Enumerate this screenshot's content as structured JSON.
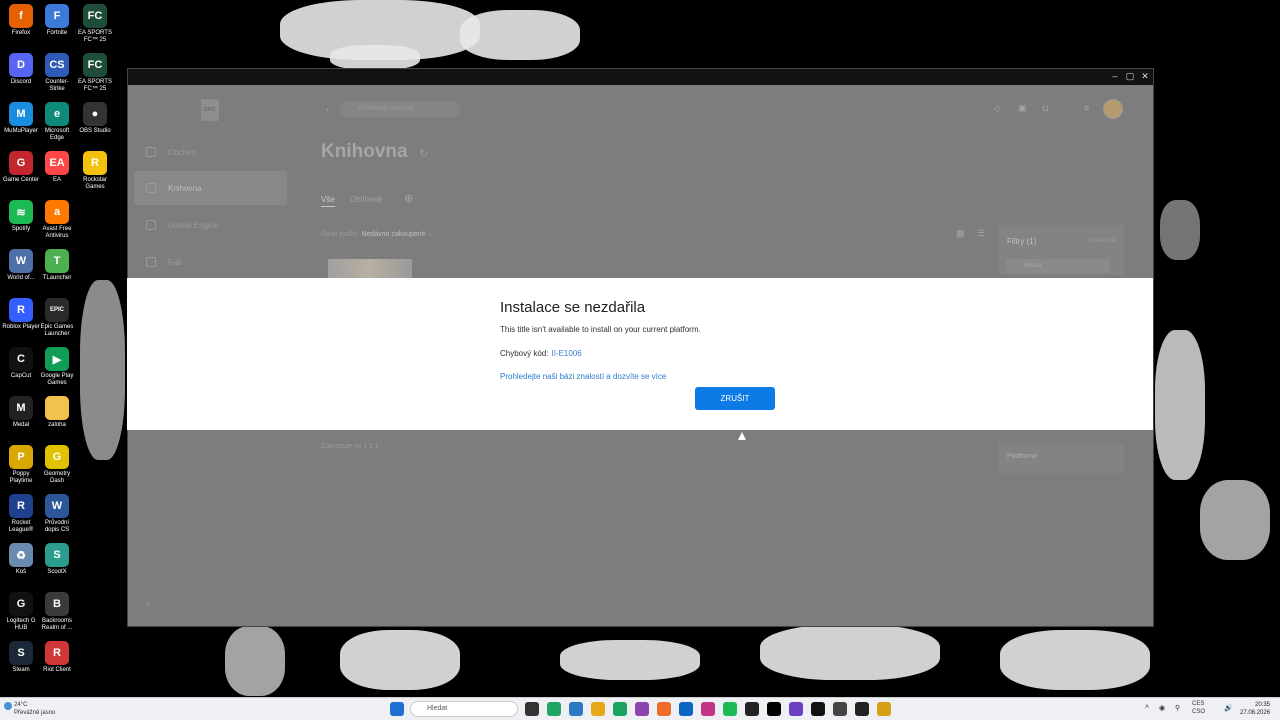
{
  "desktop": {
    "icons": [
      {
        "label": "Firefox",
        "color": "#e66000",
        "glyph": "f"
      },
      {
        "label": "Fortnite",
        "color": "#3b7ad9",
        "glyph": "F"
      },
      {
        "label": "EA SPORTS FC™ 25",
        "color": "#1e4d3a",
        "glyph": "FC"
      },
      {
        "label": "Discord",
        "color": "#5865f2",
        "glyph": "D"
      },
      {
        "label": "Counter-Strike",
        "color": "#2d5bb5",
        "glyph": "CS"
      },
      {
        "label": "EA SPORTS FC™ 25",
        "color": "#1e4d3a",
        "glyph": "FC"
      },
      {
        "label": "MuMuPlayer",
        "color": "#1b8de0",
        "glyph": "M"
      },
      {
        "label": "Microsoft Edge",
        "color": "#0f8a78",
        "glyph": "e"
      },
      {
        "label": "OBS Studio",
        "color": "#333333",
        "glyph": "●"
      },
      {
        "label": "Game Center",
        "color": "#c1272d",
        "glyph": "G"
      },
      {
        "label": "EA",
        "color": "#ff4747",
        "glyph": "EA"
      },
      {
        "label": "Rockstar Games",
        "color": "#f4c20d",
        "glyph": "R"
      },
      {
        "label": "Spotify",
        "color": "#1db954",
        "glyph": "≋"
      },
      {
        "label": "Avast Free Antivirus",
        "color": "#ff7800",
        "glyph": "a"
      },
      {
        "label": "World of...",
        "color": "#4f6fa8",
        "glyph": "W"
      },
      {
        "label": "TLauncher",
        "color": "#4caf50",
        "glyph": "T"
      },
      {
        "label": "Roblox Player",
        "color": "#335fff",
        "glyph": "R"
      },
      {
        "label": "Epic Games Launcher",
        "color": "#2a2a2a",
        "glyph": "EPIC"
      },
      {
        "label": "CapCut",
        "color": "#111111",
        "glyph": "C"
      },
      {
        "label": "Google Play Games",
        "color": "#0f9d58",
        "glyph": "▶"
      },
      {
        "label": "Medal",
        "color": "#222222",
        "glyph": "M"
      },
      {
        "label": "zaloha",
        "color": "#f2c14e",
        "glyph": ""
      },
      {
        "label": "Poppy Playtime",
        "color": "#d8a800",
        "glyph": "P"
      },
      {
        "label": "Geometry Dash",
        "color": "#e0c200",
        "glyph": "G"
      },
      {
        "label": "Rocket League®",
        "color": "#1f3f8f",
        "glyph": "R"
      },
      {
        "label": "Průvodní dopis CS",
        "color": "#2b579a",
        "glyph": "W"
      },
      {
        "label": "Koš",
        "color": "#6a8ab0",
        "glyph": "♻"
      },
      {
        "label": "ScootX",
        "color": "#2a9d8f",
        "glyph": "S"
      },
      {
        "label": "Logitech G HUB",
        "color": "#111111",
        "glyph": "G"
      },
      {
        "label": "Backrooms Realm of ...",
        "color": "#3a3a3a",
        "glyph": "B"
      },
      {
        "label": "Steam",
        "color": "#1b2838",
        "glyph": "S"
      },
      {
        "label": "Riot Client",
        "color": "#d13639",
        "glyph": "R"
      }
    ]
  },
  "window": {
    "controls": {
      "minimize": "–",
      "maximize": "▢",
      "close": "✕"
    }
  },
  "launcher": {
    "logo": "EPIC",
    "search_placeholder": "Prohledat obchod",
    "nav": [
      {
        "label": "Obchod",
        "active": false
      },
      {
        "label": "Knihovna",
        "active": true
      },
      {
        "label": "Unreal Engine",
        "active": false
      },
      {
        "label": "Fab",
        "active": false
      }
    ],
    "page_title": "Knihovna",
    "tabs": [
      {
        "label": "Vše",
        "active": true
      },
      {
        "label": "Oblíbené",
        "active": false
      }
    ],
    "sort_label": "Řadit podle:",
    "sort_value": "Nedávno zakoupené",
    "filters_title": "Filtry (1)",
    "filters_reset": "Resetovat",
    "filters_search": "Hledat",
    "platform_label": "Platforma",
    "shown_count": "Zobrazuje se 1 z 1"
  },
  "dialog": {
    "title": "Instalace se nezdařila",
    "message": "This title isn't available to install on your current platform.",
    "error_label": "Chybový kód:",
    "error_code": "II-E1006",
    "link": "Prohledejte naši bázi znalostí a dozvíte se více",
    "button": "ZRUŠIT",
    "button_color": "#0e7ae6"
  },
  "taskbar": {
    "weather_temp": "24°C",
    "weather_desc": "Převážně jasno",
    "search_placeholder": "Hledat",
    "tray_lang": "CES",
    "tray_region": "CSO",
    "time": "20:35",
    "date": "27.08.2026"
  }
}
